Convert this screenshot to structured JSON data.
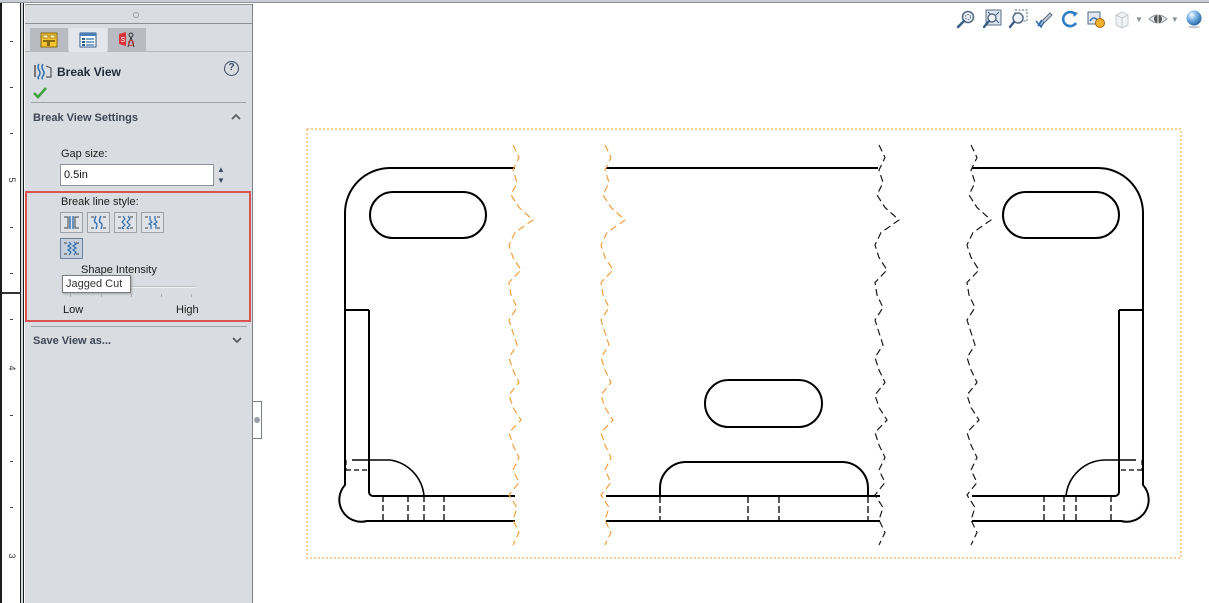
{
  "ruler": {
    "labels": [
      {
        "text": "5"
      },
      {
        "text": "4"
      },
      {
        "text": "3"
      }
    ]
  },
  "panel": {
    "tabs": [
      {
        "name": "feature-manager",
        "icon": "feature-tree-icon"
      },
      {
        "name": "property-manager",
        "icon": "property-manager-icon",
        "active": true
      },
      {
        "name": "configuration-manager",
        "icon": "dimxpert-icon"
      }
    ],
    "title": "Break View",
    "title_icon": "break-view-icon",
    "help_icon": "help-icon",
    "ok_icon": "checkmark-icon",
    "settings": {
      "title": "Break View Settings",
      "expanded": true,
      "gap_size_label": "Gap size:",
      "gap_size_value": "0.5in",
      "break_line_style_label": "Break line style:",
      "styles": [
        {
          "name": "Straight Cut"
        },
        {
          "name": "Curve Cut"
        },
        {
          "name": "Zig Zag Cut"
        },
        {
          "name": "Small Zig Zag Cut"
        },
        {
          "name": "Jagged Cut",
          "selected": true
        }
      ],
      "tooltip": "Jagged Cut",
      "shape_intensity_label": "Shape Intensity",
      "intensity_low": "Low",
      "intensity_high": "High",
      "intensity_value_fraction": 0.4
    },
    "save_view": {
      "title": "Save View as...",
      "expanded": false
    }
  },
  "hud_toolbar": {
    "buttons": [
      {
        "name": "zoom-to-fit",
        "icon": "zoom-to-fit-icon"
      },
      {
        "name": "zoom-to-area",
        "icon": "zoom-to-area-icon"
      },
      {
        "name": "zoom-to-selection",
        "icon": "zoom-to-selection-icon"
      },
      {
        "name": "previous-view",
        "icon": "previous-view-icon"
      },
      {
        "name": "rotate",
        "icon": "rotate-icon"
      },
      {
        "name": "apply-scene",
        "icon": "scene-icon"
      },
      {
        "name": "display-style",
        "icon": "display-style-icon",
        "dropdown": true
      },
      {
        "name": "hide-show-items",
        "icon": "eye-icon",
        "dropdown": true
      },
      {
        "name": "appearance",
        "icon": "appearance-sphere-icon"
      }
    ]
  },
  "colors": {
    "break_line_selected": "#f0a040",
    "break_line_default": "#1a1a1a",
    "view_boundary": "#f0a040",
    "highlight_box": "#d9534f",
    "panel_bg": "#d9dce0",
    "accent_thumb": "#2a6db5"
  }
}
